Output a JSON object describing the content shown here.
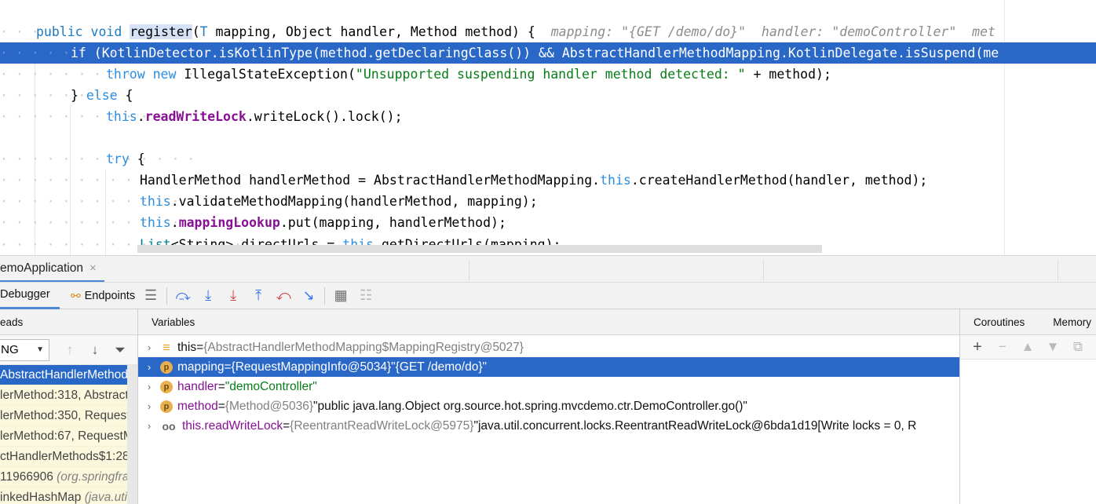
{
  "editor": {
    "lines": [
      {
        "kind": "sig",
        "public": "public",
        "void": "void",
        "name": "register",
        "paren": "(",
        "T": "T",
        "rest": " mapping, Object handler, Method method) {",
        "hint": "mapping: \"{GET /demo/do}\"  handler: \"demoController\"  met"
      },
      {
        "kind": "selected",
        "text": "if (KotlinDetector.isKotlinType(method.getDeclaringClass()) && AbstractHandlerMethodMapping.KotlinDelegate.isSuspend(me"
      },
      {
        "kind": "throw",
        "throw": "throw",
        "new": "new",
        "cls": " IllegalStateException(",
        "str": "\"Unsupported suspending handler method detected: \"",
        "rest": " + method);"
      },
      {
        "kind": "else",
        "brace": "} ",
        "else": "else",
        "rest": " {"
      },
      {
        "kind": "lock",
        "this": "this",
        "dot": ".",
        "field": "readWriteLock",
        "rest": ".writeLock().lock();"
      },
      {
        "kind": "blank"
      },
      {
        "kind": "try",
        "try": "try",
        "rest": " {"
      },
      {
        "kind": "create",
        "pre": "HandlerMethod handlerMethod = AbstractHandlerMethodMapping.",
        "this": "this",
        "rest": ".createHandlerMethod(handler, method);"
      },
      {
        "kind": "validate",
        "this": "this",
        "rest": ".validateMethodMapping(handlerMethod, mapping);"
      },
      {
        "kind": "lookup",
        "this": "this",
        "dot": ".",
        "field": "mappingLookup",
        "rest": ".put(mapping, handlerMethod);"
      },
      {
        "kind": "urls",
        "list": "List",
        "mid": "<String> directUrls = ",
        "this": "this",
        "rest": ".getDirectUrls(mapping);"
      }
    ]
  },
  "run_tab": {
    "label": "emoApplication",
    "close": "×"
  },
  "toolbar": {
    "debugger": "Debugger",
    "endpoints": "Endpoints"
  },
  "threads": {
    "header": "eads",
    "selected": "ING",
    "frames": [
      {
        "text": "AbstractHandlerMethod",
        "lib": ""
      },
      {
        "text": "lerMethod:318, Abstract",
        "lib": ""
      },
      {
        "text": "lerMethod:350, Request",
        "lib": ""
      },
      {
        "text": "lerMethod:67, RequestM",
        "lib": ""
      },
      {
        "text": "ctHandlerMethods$1:28",
        "lib": ""
      },
      {
        "text": "11966906 ",
        "lib": "(org.springfra"
      },
      {
        "text": "inkedHashMap ",
        "lib": "(java.util"
      }
    ]
  },
  "variables": {
    "header": "Variables",
    "rows": [
      {
        "icon": "bars",
        "name": "this",
        "eq": " = ",
        "ref": "{AbstractHandlerMethodMapping$MappingRegistry@5027}",
        "val": "",
        "valkind": "plain"
      },
      {
        "icon": "p",
        "name": "mapping",
        "eq": " = ",
        "ref": "{RequestMappingInfo@5034}",
        "val": " \"{GET /demo/do}\"",
        "valkind": "plain"
      },
      {
        "icon": "p",
        "name": "handler",
        "eq": " = ",
        "ref": "",
        "val": "\"demoController\"",
        "valkind": "str"
      },
      {
        "icon": "p",
        "name": "method",
        "eq": " = ",
        "ref": "{Method@5036}",
        "val": " \"public java.lang.Object org.source.hot.spring.mvcdemo.ctr.DemoController.go()\"",
        "valkind": "plain"
      },
      {
        "icon": "glasses",
        "name": "this.readWriteLock",
        "eq": " = ",
        "ref": "{ReentrantReadWriteLock@5975}",
        "val": " \"java.util.concurrent.locks.ReentrantReadWriteLock@6bda1d19[Write locks = 0, R",
        "valkind": "plain"
      }
    ]
  },
  "right_panel": {
    "coroutines": "Coroutines",
    "memory": "Memory"
  }
}
